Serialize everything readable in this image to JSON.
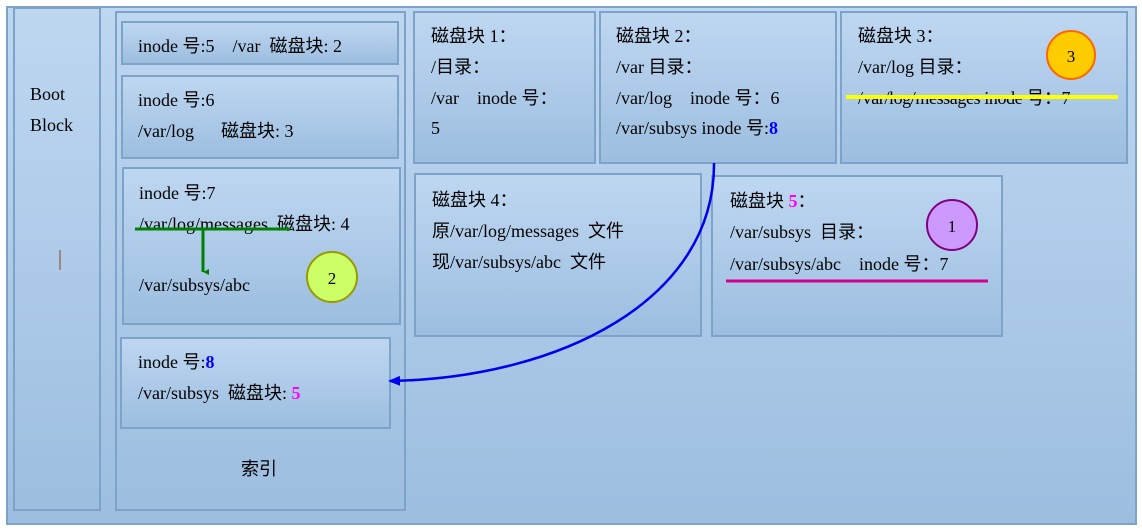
{
  "boot": {
    "line1": "Boot",
    "line2": "Block"
  },
  "index": {
    "label": "索引",
    "inode5": {
      "text": "inode 号:5    /var  磁盘块: 2"
    },
    "inode6": {
      "l1": "inode 号:6",
      "l2": "/var/log      磁盘块: 3"
    },
    "inode7": {
      "l1": "inode 号:7",
      "l2a": "/var/log/messages",
      "l2b": "  磁盘块: 4",
      "l3": "/var/subsys/abc"
    },
    "inode8": {
      "l1a": "inode 号:",
      "l1b": "8",
      "l2a": "/var/subsys  磁盘块: ",
      "l2b": "5"
    }
  },
  "blocks": {
    "b1": {
      "l1": "磁盘块 1：",
      "l2": "/目录：",
      "l3": "/var    inode 号：",
      "l4": "5"
    },
    "b2": {
      "l1": "磁盘块 2：",
      "l2": "/var 目录：",
      "l3": "/var/log    inode 号：6",
      "l4a": "/var/subsys inode 号:",
      "l4b": "8"
    },
    "b3": {
      "l1": "磁盘块 3：",
      "l2": "/var/log 目录：",
      "l3": "/var/log/messages inode 号：7"
    },
    "b4": {
      "l1": "磁盘块 4：",
      "l2": "原/var/log/messages  文件",
      "l3": "现/var/subsys/abc  文件"
    },
    "b5": {
      "l1a": "磁盘块 ",
      "l1b": "5",
      "l1c": "：",
      "l2": "/var/subsys  目录：",
      "l3": "/var/subsys/abc    inode 号：7"
    }
  },
  "markers": [
    {
      "label": "1",
      "color": "#cc99ff"
    },
    {
      "label": "2",
      "color": "#ccff66"
    },
    {
      "label": "3",
      "color": "#ffcc00"
    }
  ],
  "colors": {
    "strike_green": "#008000",
    "strike_yellow": "#ffff00",
    "underline_magenta": "#d6008f",
    "arrow_blue": "#0000ee"
  }
}
